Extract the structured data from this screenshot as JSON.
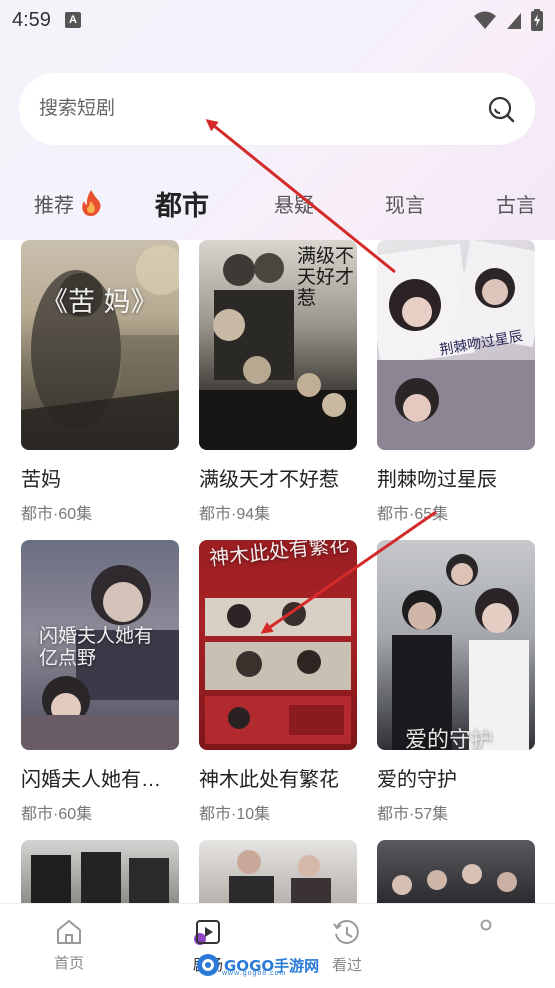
{
  "status_bar": {
    "time": "4:59",
    "notification_icon": "A"
  },
  "search": {
    "placeholder": "搜索短剧"
  },
  "tabs": [
    {
      "label": "推荐"
    },
    {
      "label": "都市"
    },
    {
      "label": "悬疑"
    },
    {
      "label": "现言"
    },
    {
      "label": "古言"
    }
  ],
  "cards": [
    {
      "title": "苦妈",
      "meta": "都市·60集",
      "poster_text": "《苦 妈》"
    },
    {
      "title": "满级天才不好惹",
      "meta": "都市·94集",
      "poster_text": "满级不天好才惹"
    },
    {
      "title": "荆棘吻过星辰",
      "meta": "都市·65集",
      "poster_text": "荆棘吻过星辰"
    },
    {
      "title": "闪婚夫人她有亿…",
      "meta": "都市·60集",
      "poster_text": "闪婚夫人她有亿点野"
    },
    {
      "title": "神木此处有繁花",
      "meta": "都市·10集",
      "poster_text": "神木此处有繁花"
    },
    {
      "title": "爱的守护",
      "meta": "都市·57集",
      "poster_text": "爱的守护"
    }
  ],
  "bottom_nav": [
    {
      "label": "首页",
      "icon": "home-icon"
    },
    {
      "label": "剧场",
      "icon": "play-icon"
    },
    {
      "label": "看过",
      "icon": "history-icon"
    },
    {
      "label": "",
      "icon": "dot-icon"
    }
  ],
  "watermark": {
    "text": "GOGO手游网",
    "sub": "www.gogo8.com"
  },
  "colors": {
    "accent": "#e05a3a",
    "arrow": "#d42a2a",
    "text_primary": "#222222",
    "text_secondary": "#777777"
  }
}
